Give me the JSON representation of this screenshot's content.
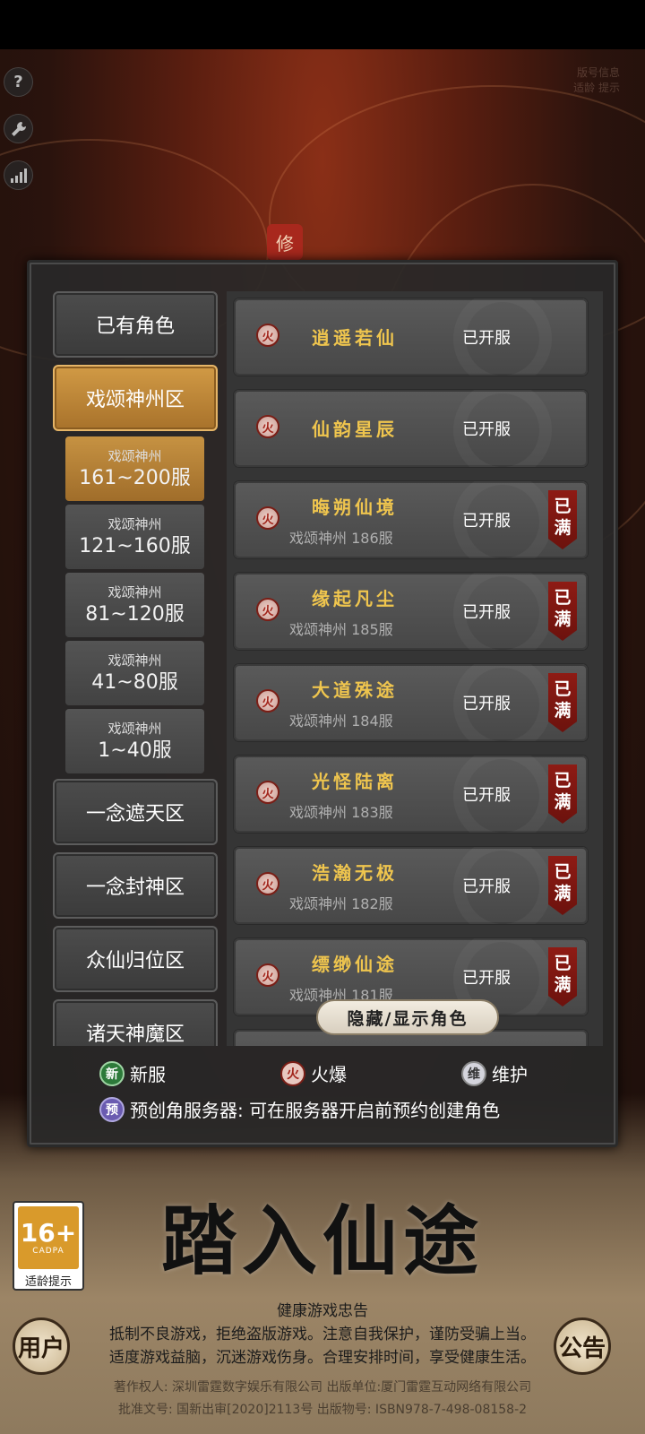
{
  "top_icons": [
    "question-icon",
    "wrench-icon",
    "signal-icon"
  ],
  "top_right_text": [
    "版号信息",
    "适龄 提示"
  ],
  "logo": {
    "seal": "修"
  },
  "categories": {
    "owned": "已有角色",
    "active_zone": "戏颂神州区",
    "zone_yinian_zhetian": "一念遮天区",
    "zone_yinian_fengshen": "一念封神区",
    "zone_zhongxian": "众仙归位区",
    "zone_zhutian": "诸天神魔区"
  },
  "subzones": [
    {
      "line1": "戏颂神州",
      "line2": "161~200服"
    },
    {
      "line1": "戏颂神州",
      "line2": "121~160服"
    },
    {
      "line1": "戏颂神州",
      "line2": "81~120服"
    },
    {
      "line1": "戏颂神州",
      "line2": "41~80服"
    },
    {
      "line1": "戏颂神州",
      "line2": "1~40服"
    }
  ],
  "servers": [
    {
      "badge": "火",
      "name": "逍遥若仙",
      "sub": "",
      "status": "已开服",
      "full": ""
    },
    {
      "badge": "火",
      "name": "仙韵星辰",
      "sub": "",
      "status": "已开服",
      "full": ""
    },
    {
      "badge": "火",
      "name": "晦朔仙境",
      "sub": "戏颂神州 186服",
      "status": "已开服",
      "full": "已满"
    },
    {
      "badge": "火",
      "name": "缘起凡尘",
      "sub": "戏颂神州 185服",
      "status": "已开服",
      "full": "已满"
    },
    {
      "badge": "火",
      "name": "大道殊途",
      "sub": "戏颂神州 184服",
      "status": "已开服",
      "full": "已满"
    },
    {
      "badge": "火",
      "name": "光怪陆离",
      "sub": "戏颂神州 183服",
      "status": "已开服",
      "full": "已满"
    },
    {
      "badge": "火",
      "name": "浩瀚无极",
      "sub": "戏颂神州 182服",
      "status": "已开服",
      "full": "已满"
    },
    {
      "badge": "火",
      "name": "缥缈仙途",
      "sub": "戏颂神州 181服",
      "status": "已开服",
      "full": "已满"
    }
  ],
  "toggle_roles": "隐藏/显示角色",
  "legend": {
    "new_badge": "新",
    "new_label": "新服",
    "hot_badge": "火",
    "hot_label": "火爆",
    "maint_badge": "维",
    "maint_label": "维护"
  },
  "info": {
    "badge": "预",
    "text": "预创角服务器: 可在服务器开启前预约创建角色"
  },
  "age": {
    "rating": "16+",
    "org": "CADPA",
    "label": "适龄提示"
  },
  "start_title": "踏入仙途",
  "buttons": {
    "left": "用户",
    "right": "公告"
  },
  "health": {
    "title": "健康游戏忠告",
    "line1": "抵制不良游戏，拒绝盗版游戏。注意自我保护，谨防受骗上当。",
    "line2": "适度游戏益脑，沉迷游戏伤身。合理安排时间，享受健康生活。"
  },
  "credits": {
    "line1": "著作权人: 深圳雷霆数字娱乐有限公司 出版单位:厦门雷霆互动网络有限公司",
    "line2": "批准文号: 国新出审[2020]2113号 出版物号: ISBN978-7-498-08158-2"
  },
  "colors": {
    "accent_gold": "#efc54e",
    "active_tab": "#c69242",
    "full_tag": "#8e1b14",
    "panel": "#353535"
  }
}
